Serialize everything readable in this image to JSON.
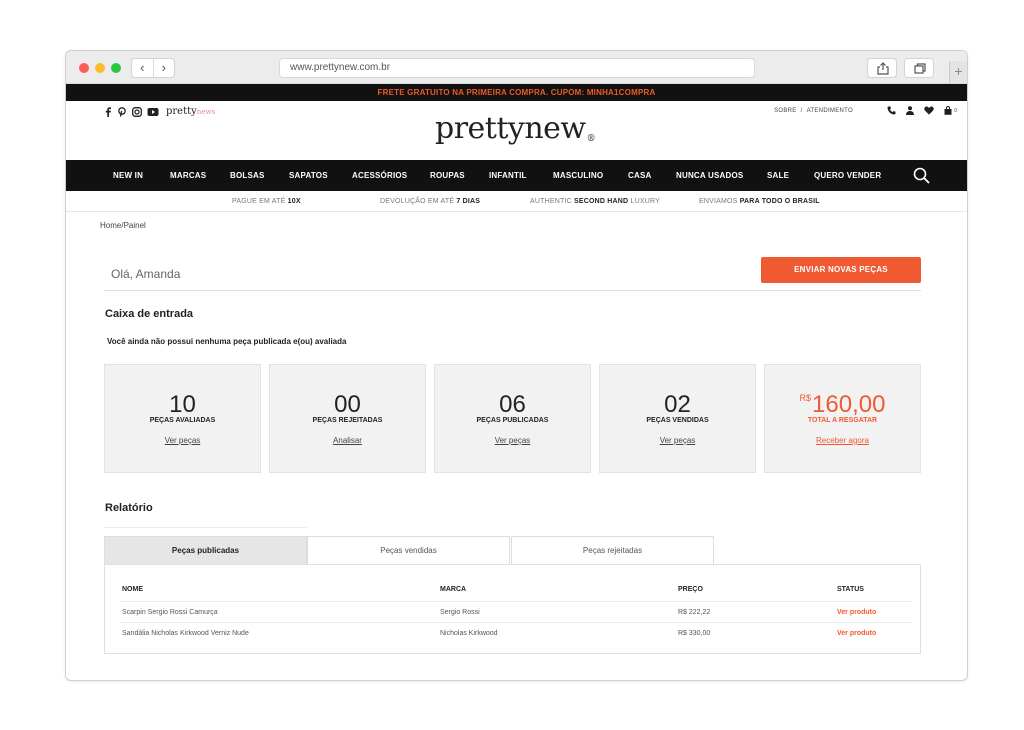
{
  "browser": {
    "url": "www.prettynew.com.br"
  },
  "promo_banner": "FRETE GRATUITO NA PRIMEIRA COMPRA. CUPOM: MINHA1COMPRA",
  "header": {
    "mini_logo": "pretty",
    "mini_logo_suffix": "news",
    "logo": "prettynew",
    "logo_mark": "®",
    "top_links": [
      "SOBRE",
      "/",
      "ATENDIMENTO"
    ],
    "cart_count": "0"
  },
  "nav": [
    "NEW IN",
    "MARCAS",
    "BOLSAS",
    "SAPATOS",
    "ACESSÓRIOS",
    "ROUPAS",
    "INFANTIL",
    "MASCULINO",
    "CASA",
    "NUNCA USADOS",
    "SALE",
    "QUERO VENDER"
  ],
  "perks": [
    {
      "text": "PAGUE EM ATÉ ",
      "bold": "10X",
      "tail": ""
    },
    {
      "text": "DEVOLUÇÃO EM ATÉ ",
      "bold": "7 DIAS",
      "tail": ""
    },
    {
      "text": "AUTHENTIC ",
      "bold": "SECOND HAND",
      "tail": " LUXURY"
    },
    {
      "text": "ENVIAMOS ",
      "bold": "PARA TODO O BRASIL",
      "tail": ""
    }
  ],
  "breadcrumb": "Home/Painel",
  "greeting": "Olá, Amanda",
  "send_button": "ENVIAR NOVAS PEÇAS",
  "inbox": {
    "title": "Caixa de entrada",
    "message": "Você ainda não possui nenhuma peça publicada e(ou) avaliada"
  },
  "cards": [
    {
      "num": "10",
      "label": "PEÇAS AVALIADAS",
      "link": "Ver peças"
    },
    {
      "num": "00",
      "label": "PEÇAS REJEITADAS",
      "link": "Analisar"
    },
    {
      "num": "06",
      "label": "PEÇAS PUBLICADAS",
      "link": "Ver peças"
    },
    {
      "num": "02",
      "label": "PEÇAS VENDIDAS",
      "link": "Ver peças"
    },
    {
      "currency": "R$",
      "num": "160,00",
      "label": "TOTAL A RESGATAR",
      "link": "Receber agora"
    }
  ],
  "report": {
    "title": "Relatório",
    "tabs": [
      "Peças publicadas",
      "Peças vendidas",
      "Peças rejeitadas"
    ],
    "headers": [
      "NOME",
      "MARCA",
      "PREÇO",
      "STATUS"
    ],
    "rows": [
      {
        "name": "Scarpin Sergio Rossi Camurça",
        "brand": "Sergio Rossi",
        "price": "R$ 222,22",
        "status": "Ver produto"
      },
      {
        "name": "Sandália Nicholas Kirkwood Verniz Nude",
        "brand": "Nicholas Kirkwood",
        "price": "R$ 330,00",
        "status": "Ver produto"
      }
    ]
  },
  "colors": {
    "accent": "#f05a33",
    "nav_bg": "#111111",
    "card_bg": "#f2f2f2"
  }
}
